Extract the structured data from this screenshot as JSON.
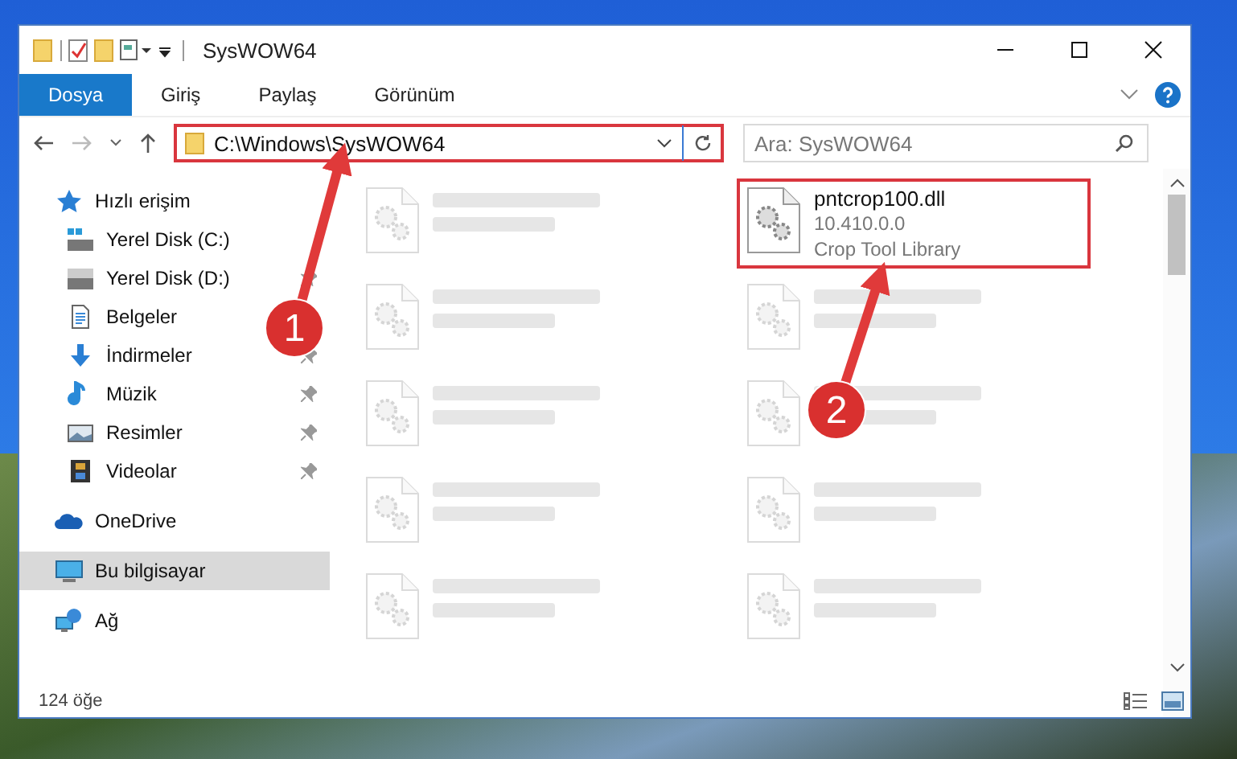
{
  "window": {
    "title": "SysWOW64"
  },
  "ribbon_tabs": [
    {
      "label": "Dosya",
      "selected": true
    },
    {
      "label": "Giriş",
      "selected": false
    },
    {
      "label": "Paylaş",
      "selected": false
    },
    {
      "label": "Görünüm",
      "selected": false
    }
  ],
  "address_bar": {
    "value": "C:\\Windows\\SysWOW64",
    "highlighted": true
  },
  "search": {
    "placeholder": "Ara: SysWOW64"
  },
  "sidebar": {
    "items": [
      {
        "label": "Hızlı erişim",
        "kind": "star",
        "pinned": false,
        "selected": false,
        "children": [
          {
            "label": "Yerel Disk (C:)",
            "kind": "drive-c",
            "pinned": false,
            "selected": false
          },
          {
            "label": "Yerel Disk (D:)",
            "kind": "drive",
            "pinned": true,
            "selected": false
          },
          {
            "label": "Belgeler",
            "kind": "docs",
            "pinned": false,
            "selected": false
          },
          {
            "label": "İndirmeler",
            "kind": "download",
            "pinned": true,
            "selected": false
          },
          {
            "label": "Müzik",
            "kind": "music",
            "pinned": true,
            "selected": false
          },
          {
            "label": "Resimler",
            "kind": "pictures",
            "pinned": true,
            "selected": false
          },
          {
            "label": "Videolar",
            "kind": "videos",
            "pinned": true,
            "selected": false
          }
        ]
      },
      {
        "label": "OneDrive",
        "kind": "cloud",
        "pinned": false,
        "selected": false
      },
      {
        "label": "Bu bilgisayar",
        "kind": "pc",
        "pinned": false,
        "selected": true
      },
      {
        "label": "Ağ",
        "kind": "network",
        "pinned": false,
        "selected": false
      }
    ]
  },
  "files": [
    {
      "blurred": true,
      "highlighted": false
    },
    {
      "name": "pntcrop100.dll",
      "version": "10.410.0.0",
      "description": "Crop Tool Library",
      "blurred": false,
      "highlighted": true
    },
    {
      "blurred": true,
      "highlighted": false
    },
    {
      "blurred": true,
      "highlighted": false
    },
    {
      "blurred": true,
      "highlighted": false
    },
    {
      "blurred": true,
      "highlighted": false
    },
    {
      "blurred": true,
      "highlighted": false
    },
    {
      "blurred": true,
      "highlighted": false
    },
    {
      "blurred": true,
      "highlighted": false
    },
    {
      "blurred": true,
      "highlighted": false
    }
  ],
  "status_bar": {
    "item_count": "124 öğe"
  },
  "annotations": [
    {
      "label": "1"
    },
    {
      "label": "2"
    }
  ]
}
